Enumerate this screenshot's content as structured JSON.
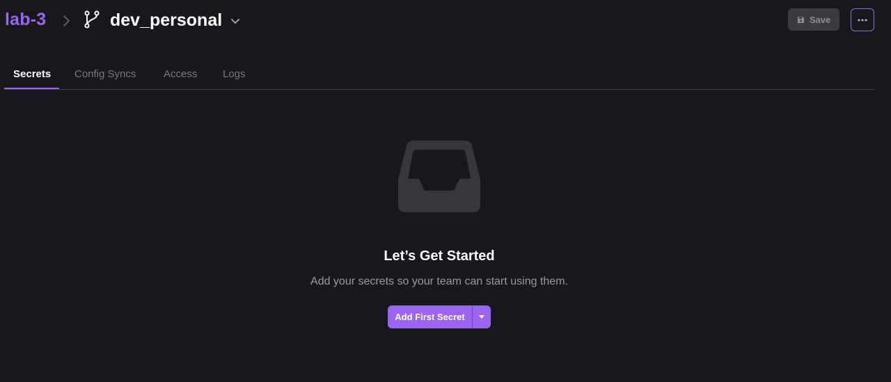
{
  "header": {
    "project_name": "lab-3",
    "branch_name": "dev_personal",
    "save_label": "Save"
  },
  "tabs": [
    {
      "label": "Secrets",
      "active": true
    },
    {
      "label": "Config Syncs",
      "active": false
    },
    {
      "label": "Access",
      "active": false
    },
    {
      "label": "Logs",
      "active": false
    }
  ],
  "empty_state": {
    "icon": "inbox-icon",
    "title": "Let’s Get Started",
    "subtitle": "Add your secrets so your team can start using them.",
    "button_label": "Add First Secret"
  },
  "icons": {
    "breadcrumb_separator": "chevron-right-icon",
    "branch": "git-branch-icon",
    "branch_dropdown": "chevron-down-icon",
    "save": "floppy-disk-icon",
    "more": "ellipsis-icon",
    "add_dropdown": "caret-down-icon"
  },
  "colors": {
    "background": "#18181c",
    "accent": "#9b65f0",
    "muted_text": "#7b7b84",
    "save_button_bg": "#3b3b40"
  }
}
